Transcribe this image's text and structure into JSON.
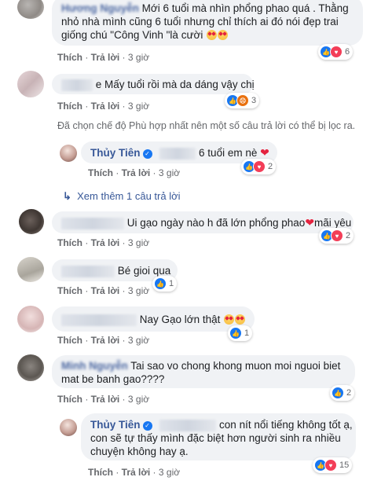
{
  "comments": [
    {
      "author": "Hương Nguyễn",
      "text": "Mới 6 tuổi mà nhìn phổng phao quá . Thằng nhỏ nhà mình cũng 6 tuổi nhưng chỉ thích ai đó nói đẹp trai giống chú \"Công Vinh \"là cười",
      "like": "Thích",
      "reply": "Trả lời",
      "time": "3 giờ",
      "react_count": "6"
    },
    {
      "text": "e Mấy tuổi rồi mà da dáng vậy chị",
      "like": "Thích",
      "reply": "Trả lời",
      "time": "3 giờ",
      "react_count": "3"
    },
    {
      "text": "Ui gạo ngày nào h đã lớn phổng phao",
      "text2": "mãi yêu",
      "like": "Thích",
      "reply": "Trả lời",
      "time": "3 giờ",
      "react_count": "2"
    },
    {
      "text": "Bé gioi qua",
      "like": "Thích",
      "reply": "Trả lời",
      "time": "3 giờ",
      "react_count": "1"
    },
    {
      "text": "Nay Gạo lớn thật",
      "like": "Thích",
      "reply": "Trả lời",
      "time": "3 giờ",
      "react_count": "1"
    },
    {
      "author": "Minh Nguyễn",
      "text": "Tai sao vo chong khong muon moi nguoi biet mat be banh gao????",
      "like": "Thích",
      "reply": "Trả lời",
      "time": "3 giờ",
      "react_count": "2"
    }
  ],
  "filter_note": "Đã chọn chế độ Phù hợp nhất nên một số câu trả lời có thể bị lọc ra.",
  "replies": [
    {
      "author": "Thủy Tiên",
      "text": "6 tuổi em nè",
      "like": "Thích",
      "reply": "Trả lời",
      "time": "3 giờ",
      "react_count": "2"
    },
    {
      "author": "Thủy Tiên",
      "text_line1": "con nít nổi tiếng không tốt ạ,",
      "text_line2": "con sẽ tự thấy mình đặc biệt hơn người sinh ra nhiều",
      "text_line3": "chuyện không hay ạ.",
      "like": "Thích",
      "reply": "Trả lời",
      "time": "3 giờ",
      "react_count": "15"
    }
  ],
  "more_replies": "Xem thêm 1 câu trả lời",
  "icons": {
    "like": "like-icon",
    "love": "love-icon",
    "angry": "angry-icon",
    "verified": "verified-icon",
    "reply_arrow": "reply-arrow-icon"
  }
}
